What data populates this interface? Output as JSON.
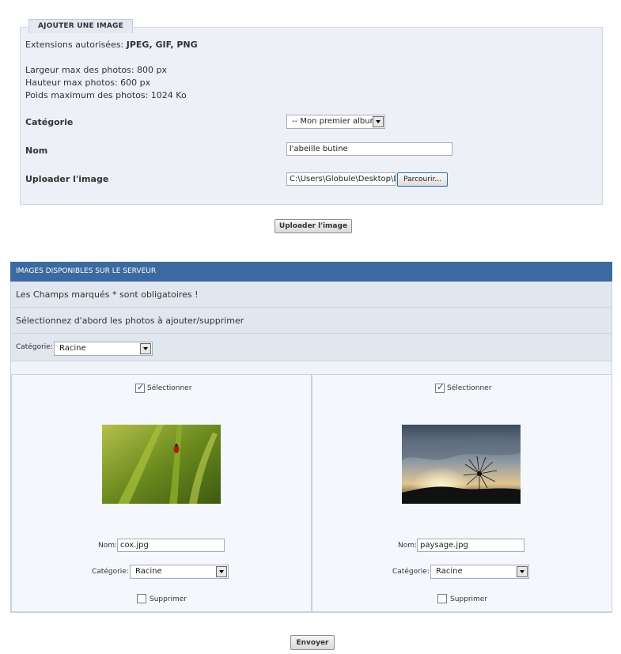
{
  "upload": {
    "legend": "AJOUTER UNE IMAGE",
    "ext_label": "Extensions autorisées:",
    "ext_value": "JPEG, GIF, PNG",
    "max_width": "Largeur max des photos: 800 px",
    "max_height": "Hauteur max photos: 600 px",
    "max_weight": "Poids maximum des photos: 1024 Ko",
    "category_label": "Catégorie",
    "category_value": "-- Mon premier album",
    "name_label": "Nom",
    "name_value": "l'abeille butine",
    "file_label": "Uploader l'image",
    "file_value": "C:\\Users\\Globule\\Desktop\\DOC",
    "browse_label": "Parcourir...",
    "submit_label": "Uploader l'image"
  },
  "server": {
    "header": "IMAGES DISPONIBLES SUR LE SERVEUR",
    "required_note": "Les Champs marqués * sont obligatoires !",
    "select_note": "Sélectionnez d'abord les photos à ajouter/supprimer",
    "category_label": "Catégorie:",
    "category_value": "Racine",
    "images": [
      {
        "select_label": "Sélectionner",
        "selected": true,
        "name_label": "Nom:",
        "name_value": "cox.jpg",
        "category_label": "Catégorie:",
        "category_value": "Racine",
        "delete_label": "Supprimer",
        "delete_checked": false
      },
      {
        "select_label": "Sélectionner",
        "selected": true,
        "name_label": "Nom:",
        "name_value": "paysage.jpg",
        "category_label": "Catégorie:",
        "category_value": "Racine",
        "delete_label": "Supprimer",
        "delete_checked": false
      }
    ],
    "submit_label": "Envoyer"
  },
  "colors": {
    "panel_header": "#3a6aa0",
    "fieldset_bg": "#eef0f7",
    "row_bg": "#e1e7ee"
  }
}
